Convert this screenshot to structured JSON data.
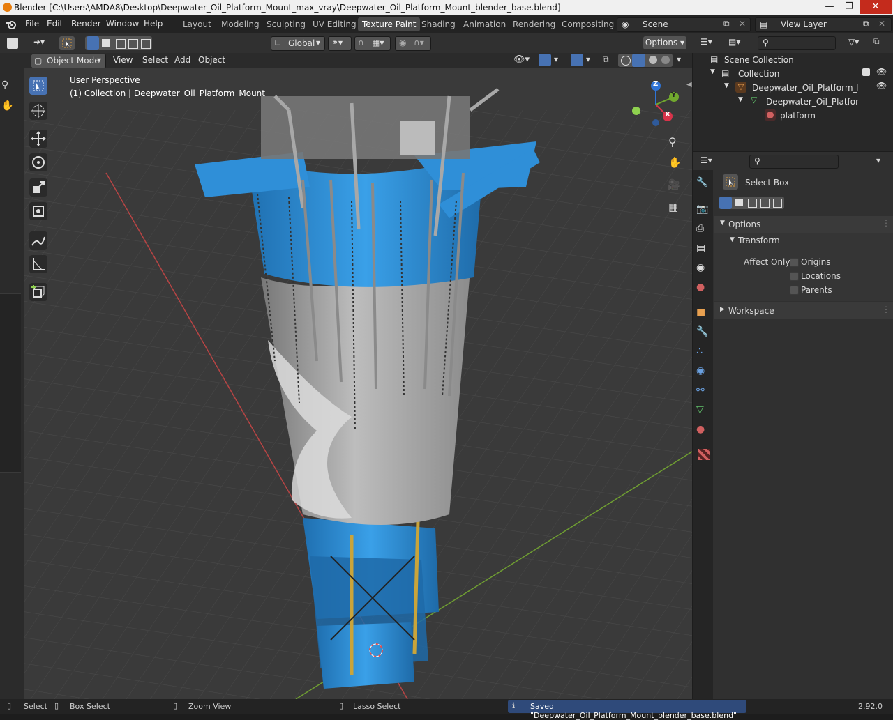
{
  "window": {
    "title": "Blender [C:\\Users\\AMDA8\\Desktop\\Deepwater_Oil_Platform_Mount_max_vray\\Deepwater_Oil_Platform_Mount_blender_base.blend]",
    "minimize": "—",
    "maximize": "❐",
    "close": "✕"
  },
  "menu": [
    "File",
    "Edit",
    "Render",
    "Window",
    "Help"
  ],
  "workspaces": [
    "Layout",
    "Modeling",
    "Sculpting",
    "UV Editing",
    "Texture Paint",
    "Shading",
    "Animation",
    "Rendering",
    "Compositing"
  ],
  "active_workspace": "Texture Paint",
  "scene": "Scene",
  "view_layer": "View Layer",
  "toolbar": {
    "orientation": "Global",
    "options": "Options"
  },
  "viewport_header": {
    "mode": "Object Mode",
    "menus": [
      "View",
      "Select",
      "Add",
      "Object"
    ]
  },
  "viewport": {
    "perspective": "User Perspective",
    "collection_info": "(1) Collection | Deepwater_Oil_Platform_Mount",
    "gizmo": {
      "z": "Z",
      "y": "Y",
      "x": "X"
    }
  },
  "outliner": {
    "items": [
      {
        "label": "Scene Collection"
      },
      {
        "label": "Collection"
      },
      {
        "label": "Deepwater_Oil_Platform_Moun"
      },
      {
        "label": "Deepwater_Oil_Platform_M"
      },
      {
        "label": "platform"
      }
    ]
  },
  "properties": {
    "tool_name": "Select Box",
    "options_label": "Options",
    "transform_label": "Transform",
    "affect_only_label": "Affect Only",
    "checkboxes": [
      {
        "label": "Origins",
        "checked": false
      },
      {
        "label": "Locations",
        "checked": false
      },
      {
        "label": "Parents",
        "checked": false
      }
    ],
    "workspace_label": "Workspace"
  },
  "statusbar": {
    "select": "Select",
    "box_select": "Box Select",
    "zoom_view": "Zoom View",
    "lasso_select": "Lasso Select",
    "message": "Saved \"Deepwater_Oil_Platform_Mount_blender_base.blend\"",
    "version": "2.92.0"
  },
  "colors": {
    "accent": "#4772b3",
    "platform_blue": "#2f8fd8",
    "x_axis": "#c84a4a",
    "y_axis": "#6f9e32",
    "gizmo_x": "#d9334a",
    "gizmo_y": "#71a82e",
    "gizmo_z": "#2f74d6"
  }
}
